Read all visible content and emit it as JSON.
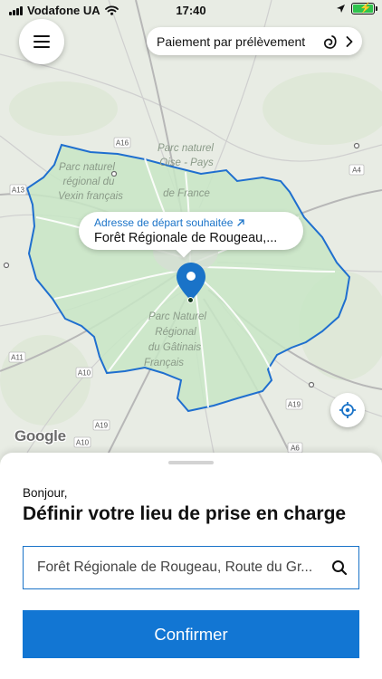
{
  "status_bar": {
    "carrier": "Vodafone UA",
    "time": "17:40"
  },
  "top_bar": {
    "menu_icon": "hamburger-menu-icon",
    "payment_label": "Paiement par prélèvement",
    "payment_icon": "direct-debit-icon",
    "chevron_icon": "chevron-right-icon"
  },
  "map": {
    "labels": {
      "a16": "A16",
      "a13": "A13",
      "a4": "A4",
      "a11": "A11",
      "a10": "A10",
      "a10b": "A10",
      "a19": "A19",
      "a19b": "A19",
      "a6": "A6",
      "parc_vexin": [
        "Parc naturel",
        "régional du",
        "Vexin français"
      ],
      "parc_oise": [
        "Parc naturel",
        "Oise - Pays",
        "de France"
      ],
      "parc_gatinais": [
        "Parc Naturel",
        "Régional",
        "du Gâtinais",
        "Français"
      ]
    },
    "address_bubble": {
      "caption": "Adresse de départ souhaitée",
      "address": "Forêt Régionale de Rougeau,..."
    },
    "google_logo": "Google",
    "colors": {
      "region_fill": "#c8e6c6",
      "region_border": "#1f6fcf",
      "pin": "#1a73c8"
    }
  },
  "sheet": {
    "greeting": "Bonjour,",
    "heading": "Définir votre lieu de prise en charge",
    "search_value": "Forêt Régionale de Rougeau, Route du Gr...",
    "confirm_label": "Confirmer",
    "accent": "#1276d3"
  }
}
